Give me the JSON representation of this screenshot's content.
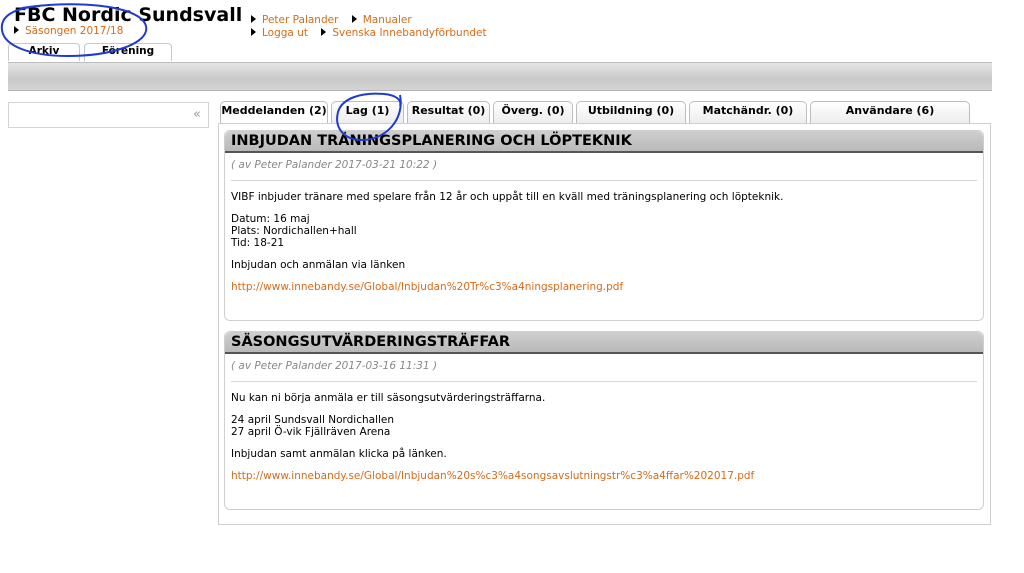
{
  "header": {
    "club_title": "FBC Nordic Sundsvall",
    "season": "Säsongen 2017/18",
    "links_row1": [
      "Peter Palander",
      "Manualer"
    ],
    "links_row2": [
      "Logga ut",
      "Svenska Innebandyförbundet"
    ]
  },
  "top_tabs": [
    "Arkiv",
    "Förening"
  ],
  "sidebar": {
    "collapse_icon": "«"
  },
  "content_tabs": [
    "Meddelanden (2)",
    "Lag (1)",
    "Resultat (0)",
    "Överg. (0)",
    "Utbildning (0)",
    "Matchändr. (0)",
    "Användare (6)"
  ],
  "messages": [
    {
      "title": "INBJUDAN TRÄNINGSPLANERING OCH LÖPTEKNIK",
      "meta": "( av  Peter Palander  2017-03-21 10:22 )",
      "intro": "VIBF inbjuder tränare med spelare från 12 år och uppåt till en kväll med träningsplanering och löpteknik.",
      "details": [
        "Datum: 16 maj",
        "Plats: Nordichallen+hall",
        "Tid: 18-21"
      ],
      "note": "Inbjudan och anmälan via länken",
      "link": "http://www.innebandy.se/Global/Inbjudan%20Tr%c3%a4ningsplanering.pdf"
    },
    {
      "title": "SÄSONGSUTVÄRDERINGSTRÄFFAR",
      "meta": "( av  Peter Palander  2017-03-16 11:31 )",
      "intro": "Nu kan ni börja anmäla er till säsongsutvärderingsträffarna.",
      "details": [
        "24 april Sundsvall Nordichallen",
        "27 april Ö-vik Fjällräven Arena"
      ],
      "note": "Inbjudan samt anmälan klicka på länken.",
      "link": "http://www.innebandy.se/Global/Inbjudan%20s%c3%a4songsavslutningstr%c3%a4ffar%202017.pdf"
    }
  ],
  "colors": {
    "link": "#d86a16",
    "annotation_ink": "#1f3bd0"
  }
}
